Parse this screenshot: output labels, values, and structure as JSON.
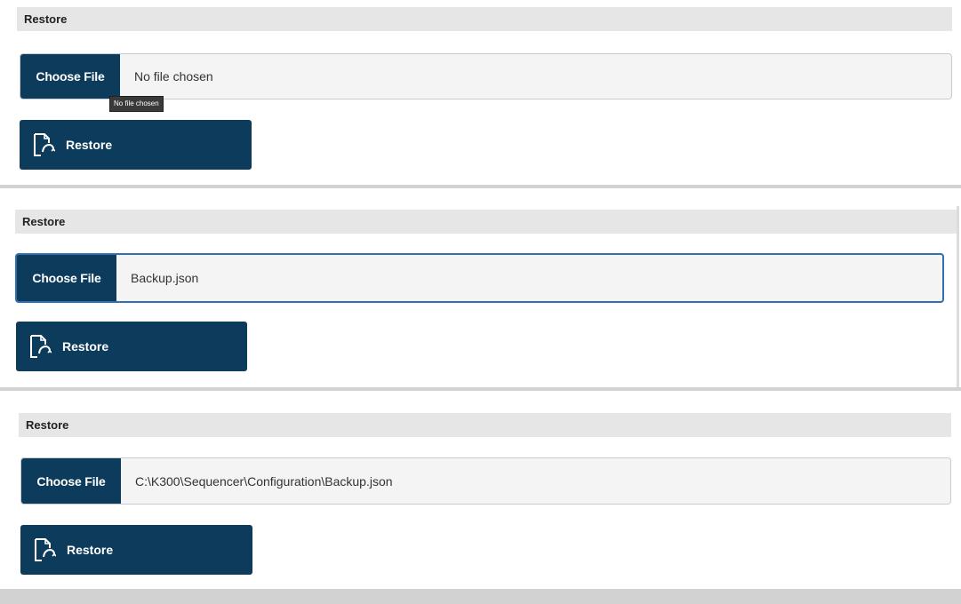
{
  "panels": [
    {
      "header": "Restore",
      "choose_label": "Choose File",
      "file_value": "No file chosen",
      "tooltip": "No file chosen",
      "restore_label": "Restore",
      "focused": false
    },
    {
      "header": "Restore",
      "choose_label": "Choose File",
      "file_value": "Backup.json",
      "restore_label": "Restore",
      "focused": true
    },
    {
      "header": "Restore",
      "choose_label": "Choose File",
      "file_value": "C:\\K300\\Sequencer\\Configuration\\Backup.json",
      "restore_label": "Restore",
      "focused": false
    }
  ],
  "colors": {
    "primary": "#0c3b5c",
    "header_bg": "#e6e6e6",
    "field_bg": "#f4f4f4",
    "focus_border": "#2f6fb3"
  },
  "icons": {
    "restore": "restore-document-icon"
  }
}
